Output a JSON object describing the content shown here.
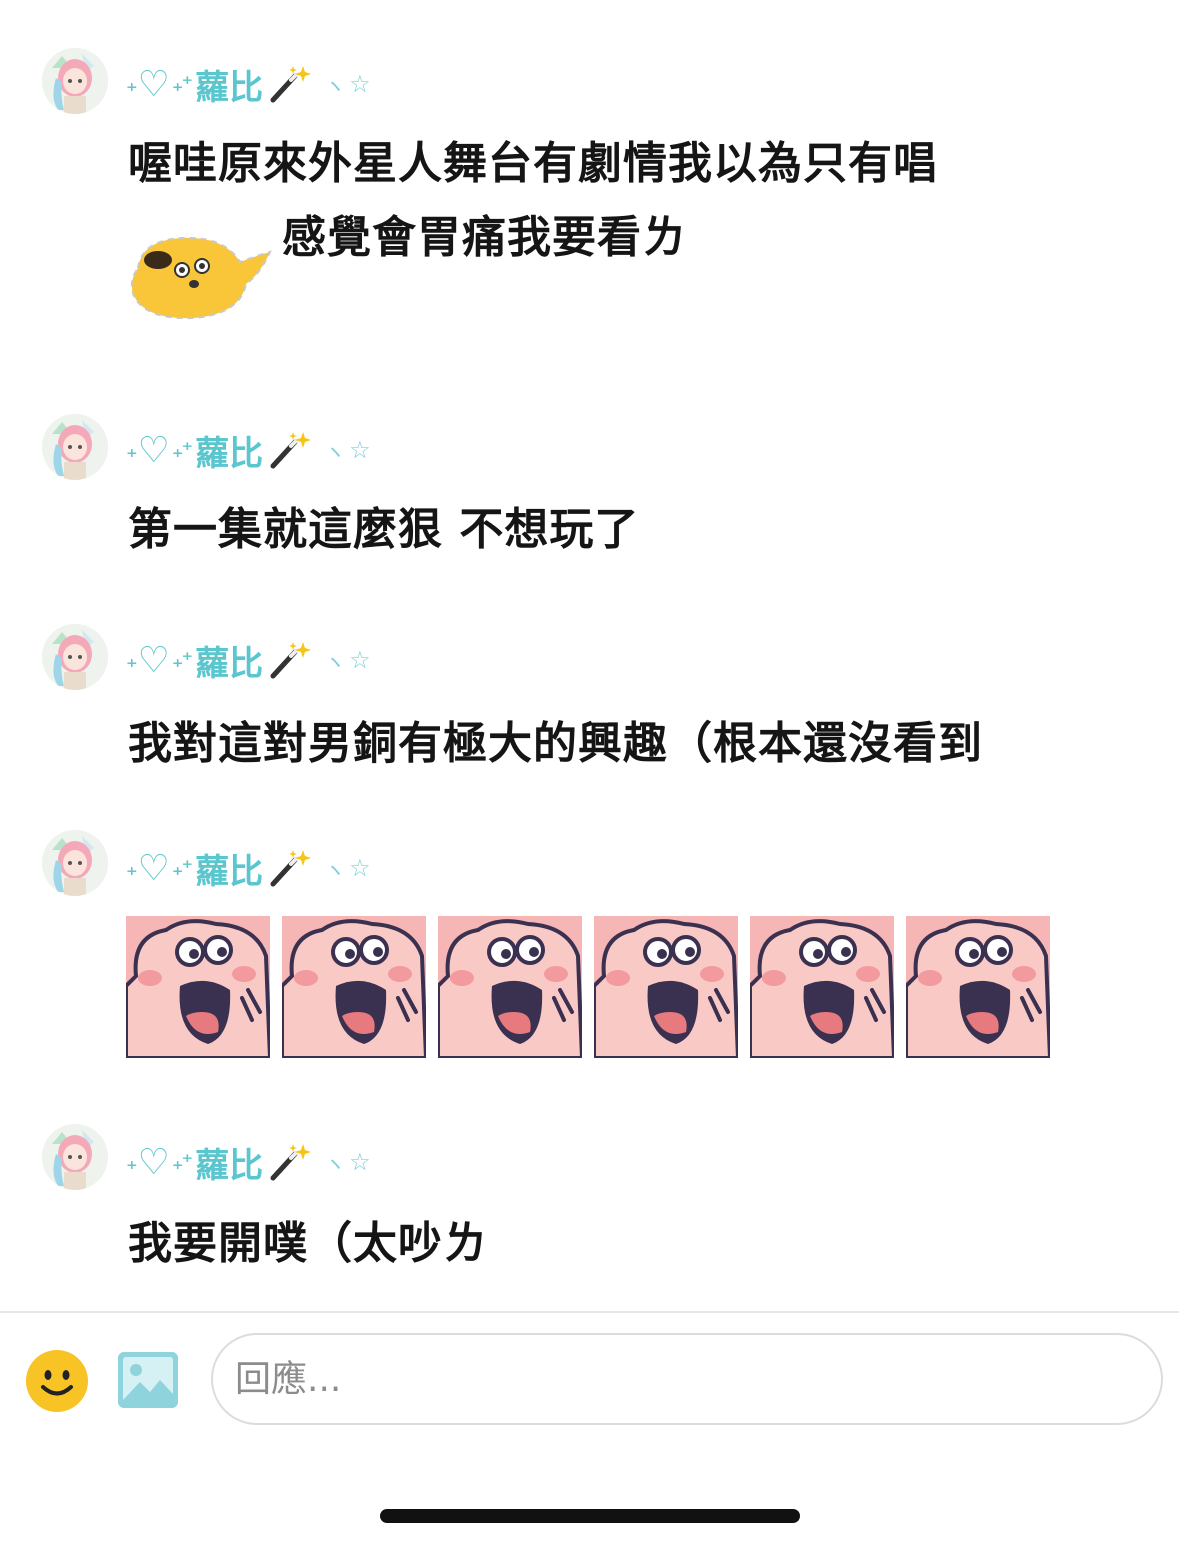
{
  "posts": [
    {
      "author": {
        "deco_left": "₊",
        "heart": "♡",
        "deco_mid": "₊⁺",
        "name": "蘿比",
        "tail": "ヽ",
        "star": "☆"
      },
      "lines": [
        "喔哇原來外星人舞台有劇情我以為只有唱",
        "感覺會胃痛我要看ㄌ"
      ],
      "sticker": "yellow-blob-sticker"
    },
    {
      "author": {
        "deco_left": "₊",
        "heart": "♡",
        "deco_mid": "₊⁺",
        "name": "蘿比",
        "tail": "ヽ",
        "star": "☆"
      },
      "lines": [
        "第一集就這麼狠 不想玩了"
      ]
    },
    {
      "author": {
        "deco_left": "₊",
        "heart": "♡",
        "deco_mid": "₊⁺",
        "name": "蘿比",
        "tail": "ヽ",
        "star": "☆"
      },
      "lines": [
        "我對這對男銅有極大的興趣（根本還沒看到"
      ]
    },
    {
      "author": {
        "deco_left": "₊",
        "heart": "♡",
        "deco_mid": "₊⁺",
        "name": "蘿比",
        "tail": "ヽ",
        "star": "☆"
      },
      "stickers": [
        "pink-shouting-sticker",
        "pink-shouting-sticker",
        "pink-shouting-sticker",
        "pink-shouting-sticker",
        "pink-shouting-sticker",
        "pink-shouting-sticker"
      ]
    },
    {
      "author": {
        "deco_left": "₊",
        "heart": "♡",
        "deco_mid": "₊⁺",
        "name": "蘿比",
        "tail": "ヽ",
        "star": "☆"
      },
      "lines": [
        "我要開噗（太吵ㄌ"
      ]
    }
  ],
  "composer": {
    "emoji_icon": "smiley-face-icon",
    "image_icon": "image-upload-icon",
    "placeholder": "回應..."
  },
  "colors": {
    "accent": "#5cc6cf",
    "sticker_pink": "#f6b6b5",
    "emoji_yellow": "#f7c325",
    "image_teal": "#8fd3dc"
  }
}
